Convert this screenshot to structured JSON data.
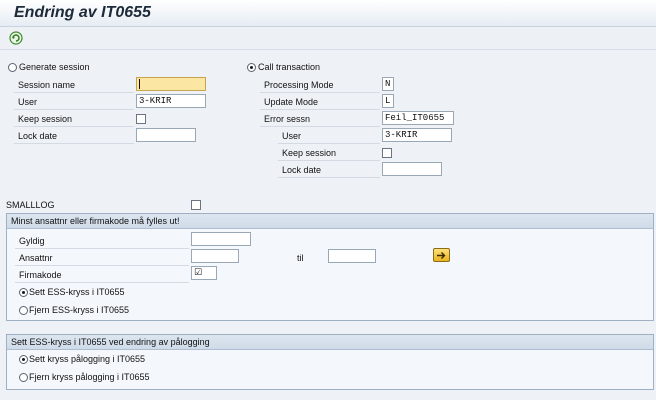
{
  "window": {
    "title": "Endring av IT0655"
  },
  "toolbar": {
    "execute_icon": "execute-icon"
  },
  "session": {
    "generate_session_label": "Generate session",
    "session_name_label": "Session name",
    "session_name_value": "",
    "user_label": "User",
    "user_value": "3-KRIR",
    "keep_session_label": "Keep session",
    "lock_date_label": "Lock date",
    "lock_date_value": ""
  },
  "call_transaction": {
    "label": "Call transaction",
    "processing_mode_label": "Processing Mode",
    "processing_mode_value": "N",
    "update_mode_label": "Update Mode",
    "update_mode_value": "L",
    "error_sessn_label": "Error sessn",
    "error_sessn_value": "Feil_IT0655",
    "user_label": "User",
    "user_value": "3-KRIR",
    "keep_session_label": "Keep session",
    "lock_date_label": "Lock date",
    "lock_date_value": ""
  },
  "smalllog": {
    "label": "SMALLLOG",
    "checked": false
  },
  "selection": {
    "title": "Minst ansattnr eller firmakode må fylles ut!",
    "gyldig_label": "Gyldig",
    "gyldig_value": "",
    "ansattnr_label": "Ansattnr",
    "ansattnr_value": "",
    "til_label": "til",
    "til_value": "",
    "firmakode_label": "Firmakode",
    "firmakode_value": "☑",
    "sett_ess_label": "Sett ESS-kryss i IT0655",
    "fjern_ess_label": "Fjern ESS-kryss i IT0655"
  },
  "login_section": {
    "title": "Sett ESS-kryss i IT0655 ved endring av pålogging",
    "sett_label": "Sett kryss pålogging i IT0655",
    "fjern_label": "Fjern kryss pålogging i IT0655"
  },
  "colors": {
    "focus_field": "#fbe7a3",
    "section_header": "#cfdbe8",
    "multi_button": "#e7b321"
  }
}
